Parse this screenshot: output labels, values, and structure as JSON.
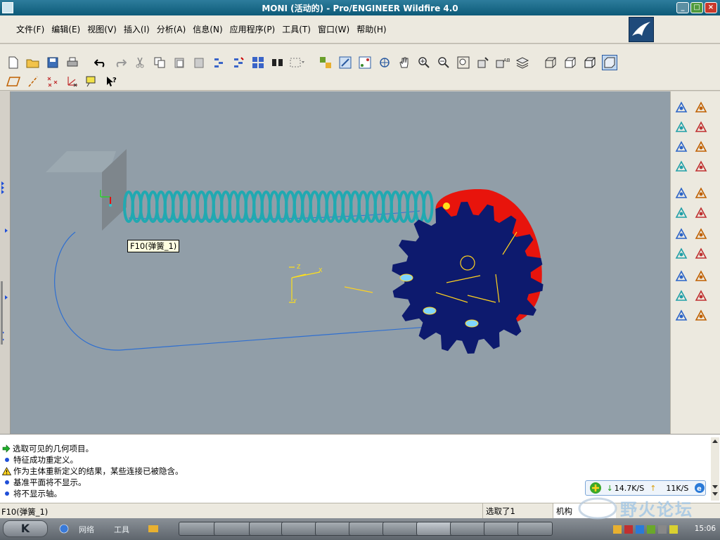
{
  "window": {
    "title": "MONI (活动的) - Pro/ENGINEER Wildfire 4.0",
    "buttons": [
      "_",
      "□",
      "×"
    ]
  },
  "menu": {
    "items": [
      "文件(F)",
      "编辑(E)",
      "视图(V)",
      "插入(I)",
      "分析(A)",
      "信息(N)",
      "应用程序(P)",
      "工具(T)",
      "窗口(W)",
      "帮助(H)"
    ]
  },
  "toolbar": {
    "row1": [
      "new-file-icon",
      "open-folder-icon",
      "save-icon",
      "print-icon",
      "undo-icon",
      "redo-icon",
      "cut-icon",
      "copy-icon",
      "paste-icon",
      "paste-special-icon",
      "regenerate-icon",
      "regenerate-manager-icon",
      "model-tree-icon",
      "find-icon",
      "select-box-icon",
      "layer-icon",
      "repaint-icon",
      "spin-center-icon",
      "orient-mode-icon",
      "pan-hand-icon",
      "zoom-in-icon",
      "zoom-out-icon",
      "refit-icon",
      "reorient-icon",
      "saved-views-icon",
      "layers-icon",
      "wireframe-icon",
      "hidden-line-icon",
      "no-hidden-icon",
      "shading-icon"
    ],
    "row2": [
      "datum-plane-icon",
      "datum-axis-icon",
      "datum-point-icon",
      "coordinate-system-icon",
      "annotation-icon",
      "whats-this-icon"
    ]
  },
  "viewport": {
    "tooltip": "F10(弹簧_1)",
    "colors": {
      "background": "#919ea8",
      "spring": "#2ec6cc",
      "gear": "#0d1a6e",
      "highlight": "#e8140c"
    }
  },
  "right_toolbar": {
    "icons": [
      "datum-display-icon",
      "sketch-curve-icon",
      "sketch-tool-icon",
      "plane-icon",
      "gear-tool-icon",
      "axis-line-icon",
      "curve-icon",
      "spline-icon",
      "servo-motor-icon",
      "point-tool-icon",
      "drag-icon",
      "coordinate-icon",
      "analysis-graph-icon",
      "plane-alt-icon",
      "gravity-icon",
      "spring-icon",
      "damper-icon",
      "force-icon",
      "initial-condition-icon",
      "mass-icon",
      "connection-icon",
      "table-icon"
    ]
  },
  "messages": [
    {
      "icon": "arrow",
      "text": "选取可见的几何项目。"
    },
    {
      "icon": "bullet",
      "text": "特征成功重定义。"
    },
    {
      "icon": "warning",
      "text": "作为主体重新定义的结果，某些连接已被隐含。"
    },
    {
      "icon": "bullet",
      "text": "基准平面将不显示。"
    },
    {
      "icon": "bullet",
      "text": "将不显示轴。"
    }
  ],
  "network": {
    "down": "14.7K/S",
    "up": "11K/S"
  },
  "status": {
    "message": "F10(弹簧_1)",
    "selected": "选取了1",
    "filter": "机构"
  },
  "taskbar": {
    "start": "K",
    "network_label": "网络",
    "tools_label": "工具",
    "clock": "15:06"
  },
  "watermark": {
    "text": "野火论坛"
  }
}
